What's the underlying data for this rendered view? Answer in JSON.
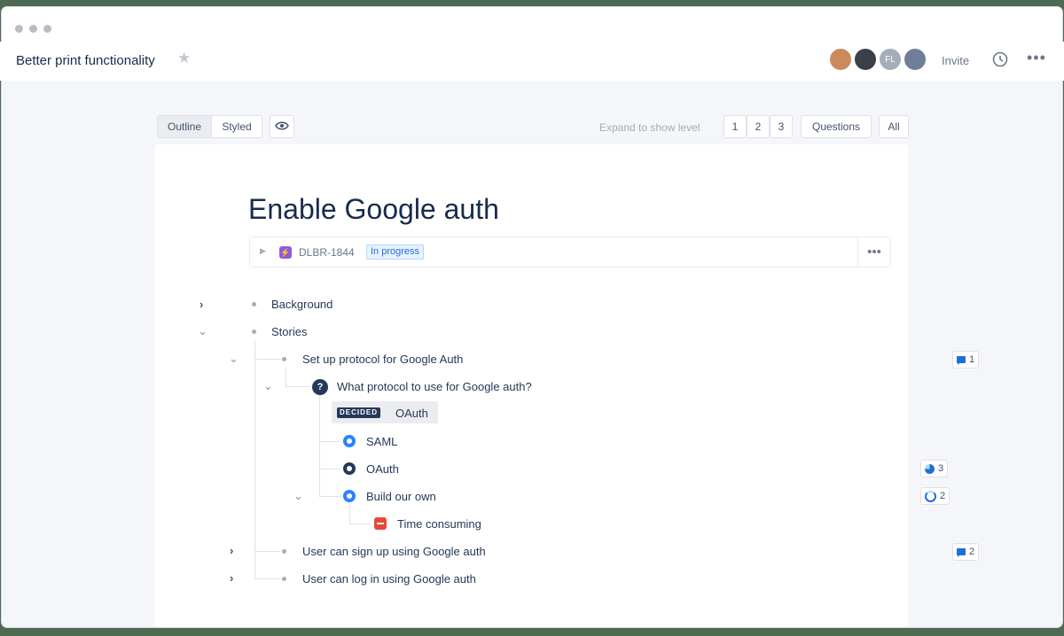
{
  "window": {
    "title": "Better print functionality"
  },
  "header": {
    "avatars": [
      {
        "name": "avatar-1",
        "initials": "",
        "color": "#c98a5e"
      },
      {
        "name": "avatar-2",
        "initials": "",
        "color": "#3b3f4a"
      },
      {
        "name": "avatar-3",
        "initials": "FL",
        "color": "#a5adba"
      },
      {
        "name": "avatar-4",
        "initials": "",
        "color": "#6f7f9a"
      }
    ],
    "invite_label": "Invite"
  },
  "toolbar": {
    "view_tabs": [
      "Outline",
      "Styled"
    ],
    "selected_view": "Outline",
    "expand_label": "Expand to show level",
    "levels": [
      "1",
      "2",
      "3"
    ],
    "filters": [
      "Questions",
      "All"
    ]
  },
  "document": {
    "title": "Enable Google auth",
    "issue": {
      "key": "DLBR-1844",
      "status": "In progress"
    }
  },
  "outline": {
    "background": "Background",
    "stories": "Stories",
    "setup": "Set up protocol for Google Auth",
    "question": "What protocol to use for Google auth?",
    "decided_tag": "DECIDED",
    "decided_value": "OAuth",
    "option_saml": "SAML",
    "option_oauth": "OAuth",
    "option_build": "Build our own",
    "con": "Time consuming",
    "signup": "User can sign up using Google auth",
    "login": "User can log in using Google auth"
  },
  "badges": {
    "setup_comments": "1",
    "oauth_votes": "3",
    "build_votes": "2",
    "signup_comments": "2"
  },
  "colors": {
    "accent": "#2684ff",
    "dark": "#253858",
    "status_blue": "#1d6fd8",
    "con_red": "#e5493a",
    "issue_purple": "#8f5bd6"
  }
}
